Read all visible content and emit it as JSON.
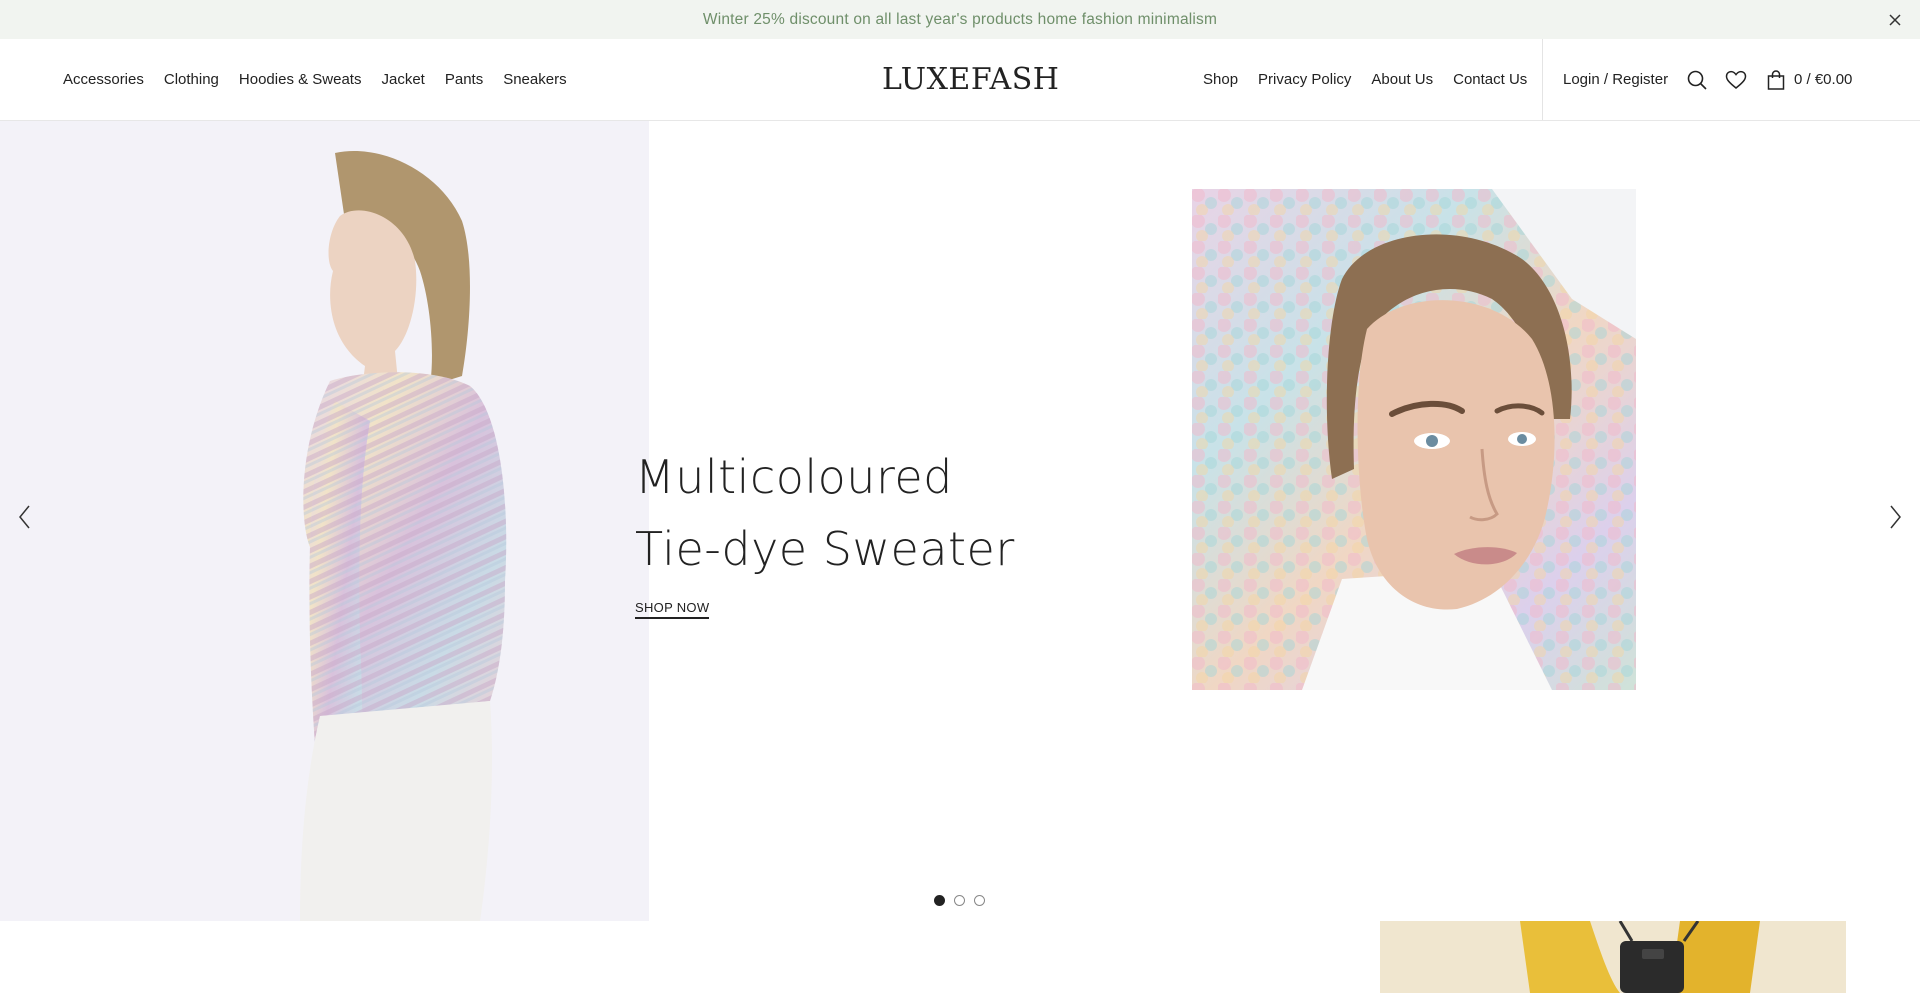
{
  "announcement": {
    "text": "Winter 25% discount on all last year's products home fashion minimalism"
  },
  "header": {
    "nav_left": [
      "Accessories",
      "Clothing",
      "Hoodies & Sweats",
      "Jacket",
      "Pants",
      "Sneakers"
    ],
    "logo": "LUXEFASH",
    "nav_right": [
      "Shop",
      "Privacy Policy",
      "About Us",
      "Contact Us"
    ],
    "account_label": "Login / Register",
    "cart_total": "0 / €0.00"
  },
  "hero": {
    "title_line1": "Multicoloured",
    "title_line2": "Tie-dye Sweater",
    "cta": "SHOP NOW",
    "slide_count": 3,
    "active_slide": 1
  },
  "colors": {
    "announcement_bg": "#f1f4f0",
    "announcement_text": "#6f8f6a",
    "text": "#222222",
    "hero_left_bg": "#f3f2f8"
  },
  "icons": [
    "close-icon",
    "search-icon",
    "heart-icon",
    "bag-icon",
    "chevron-left-icon",
    "chevron-right-icon"
  ]
}
